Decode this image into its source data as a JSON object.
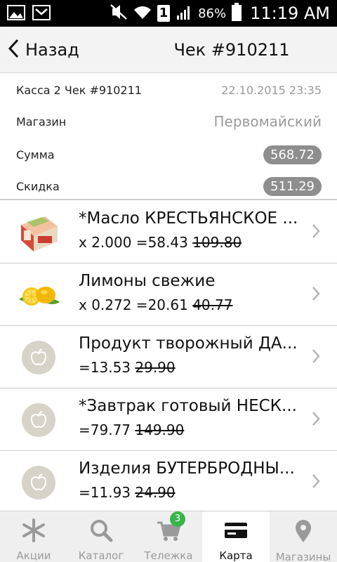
{
  "status_bar": {
    "sim_badge": "1",
    "battery_percent": "86%",
    "time": "11:19 AM"
  },
  "header": {
    "back_label": "Назад",
    "title": "Чек #910211"
  },
  "receipt": {
    "register_check": "Касса 2 Чек #910211",
    "datetime": "22.10.2015 23:35",
    "store_label": "Магазин",
    "store_value": "Первомайский",
    "sum_label": "Сумма",
    "sum_value": "568.72",
    "discount_label": "Скидка",
    "discount_value": "511.29"
  },
  "items": [
    {
      "name": "*Масло КРЕСТЬЯНСКОЕ ...",
      "price_prefix": "x 2.000 =58.43",
      "old_price": "109.80",
      "thumb": "butter-pack-icon"
    },
    {
      "name": "Лимоны свежие",
      "price_prefix": "x 0.272 =20.61",
      "old_price": "40.77",
      "thumb": "lemon-icon"
    },
    {
      "name": "Продукт творожный ДА...",
      "price_prefix": "=13.53",
      "old_price": "29.90",
      "thumb": "placeholder-apple-icon"
    },
    {
      "name": "*Завтрак готовый НЕСК...",
      "price_prefix": "=79.77",
      "old_price": "149.90",
      "thumb": "placeholder-apple-icon"
    },
    {
      "name": "Изделия БУТЕРБРОДНЫ...",
      "price_prefix": "=11.93",
      "old_price": "24.90",
      "thumb": "placeholder-apple-icon"
    }
  ],
  "bottom_nav": {
    "items": [
      {
        "label": "Акции",
        "icon": "promo-asterisk-icon",
        "active": false
      },
      {
        "label": "Каталог",
        "icon": "search-icon",
        "active": false
      },
      {
        "label": "Тележка",
        "icon": "cart-icon",
        "active": false,
        "badge": "3"
      },
      {
        "label": "Карта",
        "icon": "card-icon",
        "active": true
      },
      {
        "label": "Магазины",
        "icon": "location-pin-icon",
        "active": false
      }
    ]
  },
  "colors": {
    "badge_green": "#39b54a",
    "pill_gray": "#8e8e8e",
    "muted_text": "#9a9a9a"
  }
}
